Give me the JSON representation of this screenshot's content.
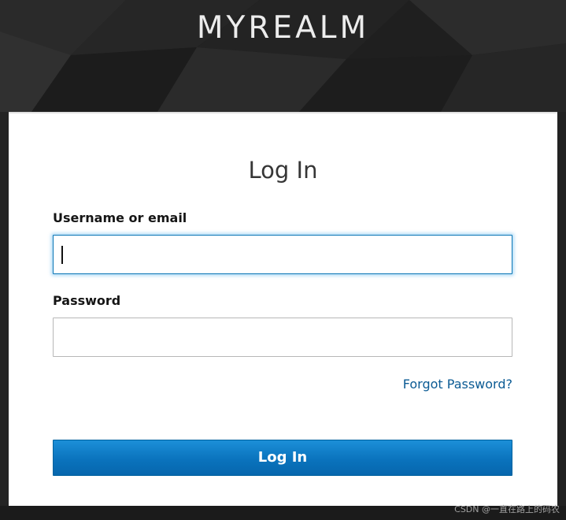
{
  "header": {
    "realm_name": "MYREALM"
  },
  "login_card": {
    "title": "Log In",
    "username_label": "Username or email",
    "username_value": "",
    "password_label": "Password",
    "password_value": "",
    "forgot_password_link": "Forgot Password?",
    "submit_label": "Log In"
  },
  "footer": {
    "watermark": "CSDN @一直在路上的码农"
  },
  "colors": {
    "background": "#1e1e1e",
    "card": "#ffffff",
    "primary_button": "#0a73bd",
    "link": "#0b5b94",
    "focus_border": "#0a76b6"
  }
}
